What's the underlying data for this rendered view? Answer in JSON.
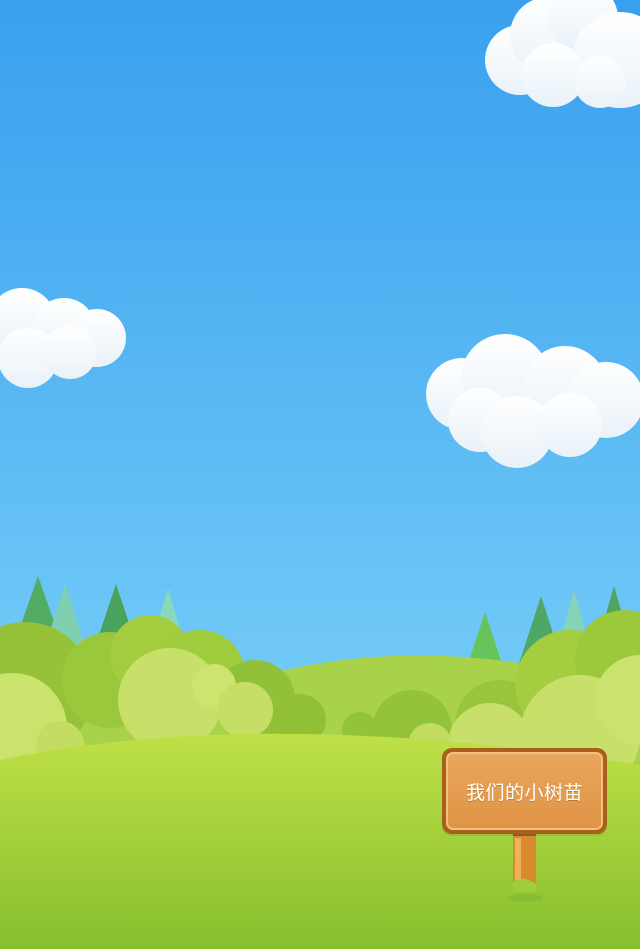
{
  "scene": {
    "sky_top_color": "#3aa2ef",
    "sky_bottom_color": "#86d6fb",
    "grass_color": "#9fd03a"
  },
  "signboard": {
    "label": "我们的小树苗",
    "board_color": "#e29a4c",
    "post_color": "#d98a2e"
  }
}
